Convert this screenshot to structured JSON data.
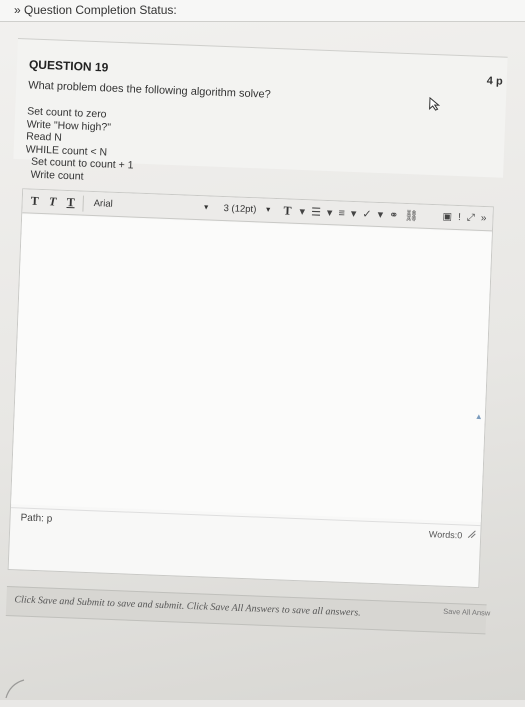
{
  "status_bar": {
    "label": "Question Completion Status:"
  },
  "question": {
    "number_label": "QUESTION 19",
    "points": "4 p",
    "prompt": "What problem does the following algorithm solve?",
    "algorithm_lines": [
      "Set count to zero",
      "Write \"How high?\"",
      "Read N",
      "WHILE count < N",
      "  Set count to count + 1",
      "  Write count"
    ]
  },
  "editor": {
    "font": "Arial",
    "size": "3 (12pt)",
    "path_label": "Path: p",
    "words_label": "Words:0"
  },
  "footer": {
    "instruction": "Click Save and Submit to save and submit. Click Save All Answers to save all answers.",
    "save_all_label": "Save All Answ"
  }
}
